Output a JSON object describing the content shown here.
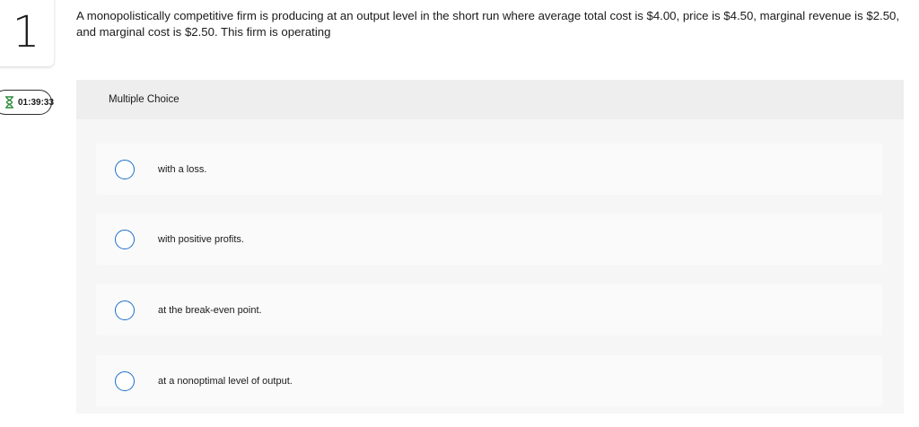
{
  "question": {
    "number": "1",
    "text": "A monopolistically competitive firm is producing at an output level in the short run where average total cost is $4.00, price is $4.50, marginal revenue is $2.50, and marginal cost is $2.50. This firm is operating"
  },
  "timer": {
    "value": "01:39:33",
    "icon": "hourglass-icon",
    "color": "#2e8b3d"
  },
  "multiple_choice": {
    "header": "Multiple Choice",
    "options": [
      {
        "label": "with a loss."
      },
      {
        "label": "with positive profits."
      },
      {
        "label": "at the break-even point."
      },
      {
        "label": "at a nonoptimal level of output."
      }
    ],
    "radio_color": "#1a6fc8"
  }
}
